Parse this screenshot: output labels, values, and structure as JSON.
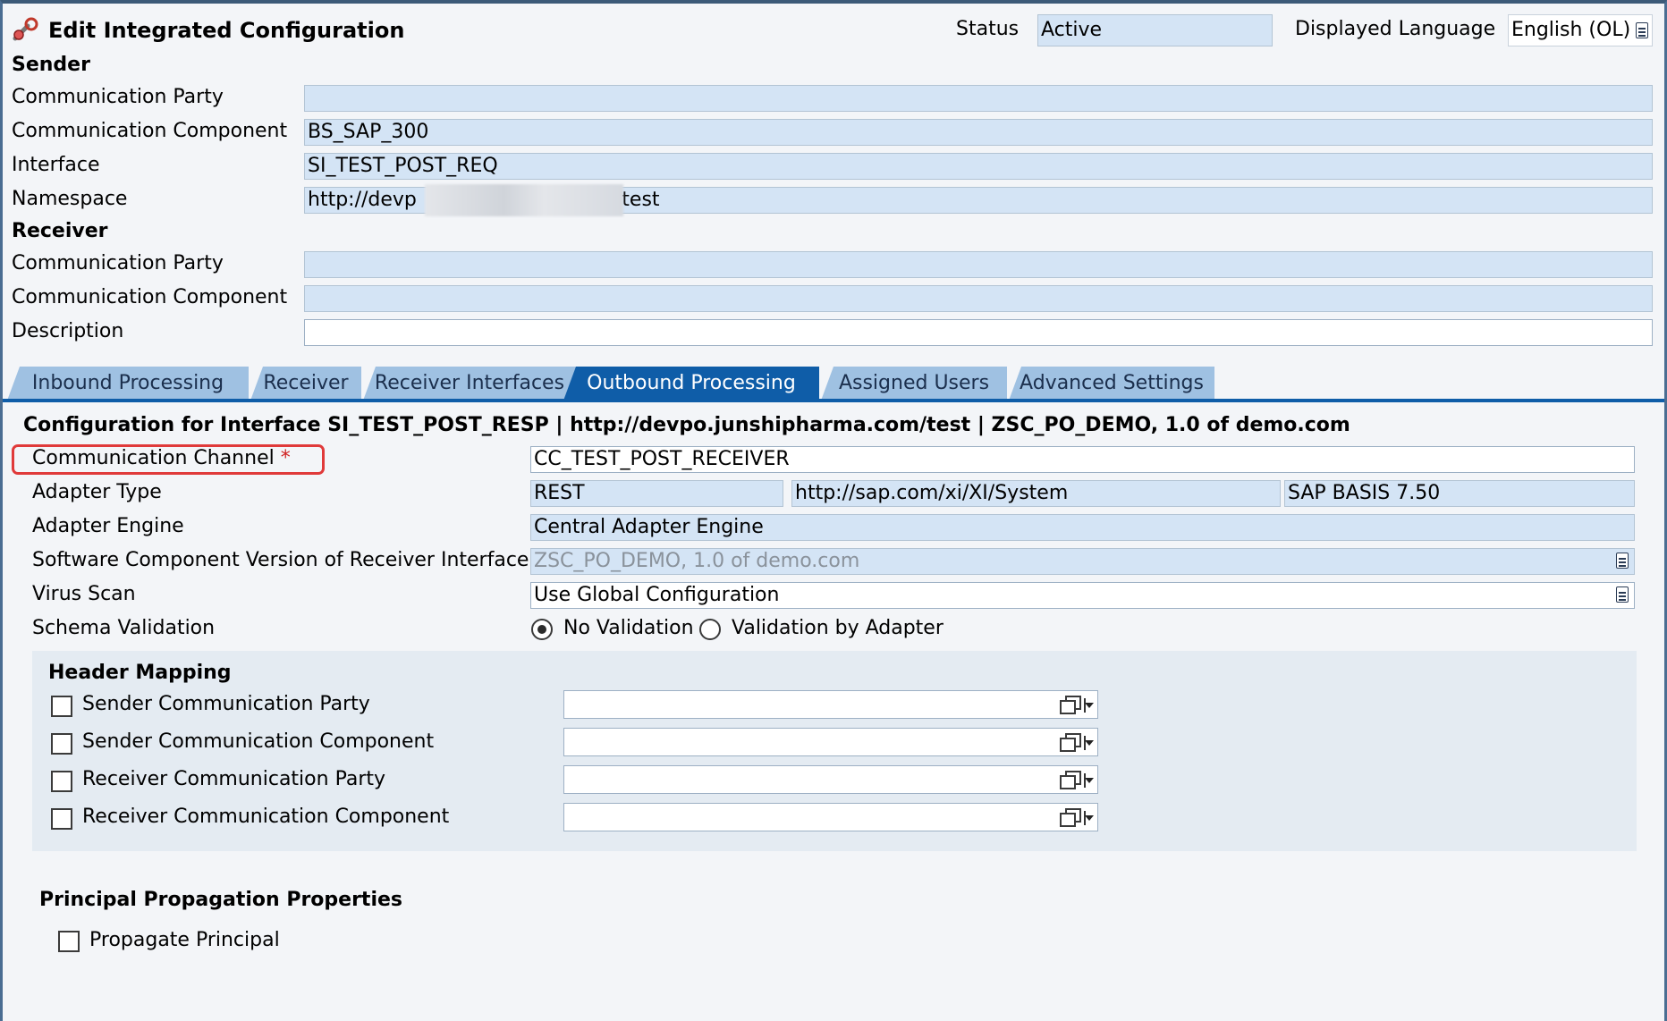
{
  "header": {
    "title": "Edit Integrated Configuration",
    "status_label": "Status",
    "status_value": "Active",
    "language_label": "Displayed Language",
    "language_value": "English (OL)"
  },
  "sender": {
    "section": "Sender",
    "party_label": "Communication Party",
    "party_value": "",
    "component_label": "Communication Component",
    "component_value": "BS_SAP_300",
    "interface_label": "Interface",
    "interface_value": "SI_TEST_POST_REQ",
    "namespace_label": "Namespace",
    "namespace_prefix": "http://devp",
    "namespace_suffix": "/test"
  },
  "receiver": {
    "section": "Receiver",
    "party_label": "Communication Party",
    "party_value": "",
    "component_label": "Communication Component",
    "component_value": ""
  },
  "description": {
    "label": "Description",
    "value": ""
  },
  "tabs": [
    {
      "label": "Inbound Processing",
      "active": false
    },
    {
      "label": "Receiver",
      "active": false
    },
    {
      "label": "Receiver Interfaces",
      "active": false
    },
    {
      "label": "Outbound Processing",
      "active": true
    },
    {
      "label": "Assigned Users",
      "active": false
    },
    {
      "label": "Advanced Settings",
      "active": false
    }
  ],
  "outbound": {
    "config_title": "Configuration for Interface SI_TEST_POST_RESP | http://devpo.junshipharma.com/test | ZSC_PO_DEMO, 1.0 of demo.com",
    "channel_label": "Communication Channel",
    "required_mark": "*",
    "channel_value": "CC_TEST_POST_RECEIVER",
    "adapter_type_label": "Adapter Type",
    "adapter_type": "REST",
    "adapter_namespace": "http://sap.com/xi/XI/System",
    "adapter_swc": "SAP BASIS 7.50",
    "adapter_engine_label": "Adapter Engine",
    "adapter_engine": "Central Adapter Engine",
    "swcv_label": "Software Component Version of Receiver Interface",
    "swcv_value": "ZSC_PO_DEMO, 1.0 of demo.com",
    "virus_label": "Virus Scan",
    "virus_value": "Use Global Configuration",
    "schema_label": "Schema Validation",
    "schema_options": [
      "No Validation",
      "Validation by Adapter"
    ],
    "schema_selected": "No Validation"
  },
  "header_mapping": {
    "title": "Header Mapping",
    "rows": [
      {
        "label": "Sender Communication Party",
        "checked": false,
        "value": ""
      },
      {
        "label": "Sender Communication Component",
        "checked": false,
        "value": ""
      },
      {
        "label": "Receiver Communication Party",
        "checked": false,
        "value": ""
      },
      {
        "label": "Receiver Communication Component",
        "checked": false,
        "value": ""
      }
    ]
  },
  "principal": {
    "title": "Principal Propagation Properties",
    "propagate_label": "Propagate Principal",
    "propagate_checked": false
  },
  "icons": [
    "config-icon",
    "dropdown-list-icon",
    "value-help-icon"
  ],
  "colors": {
    "field_bg": "#d4e4f5",
    "tab": "#9fc1e2",
    "tab_active": "#0f5da8",
    "highlight": "#e03a3a"
  }
}
